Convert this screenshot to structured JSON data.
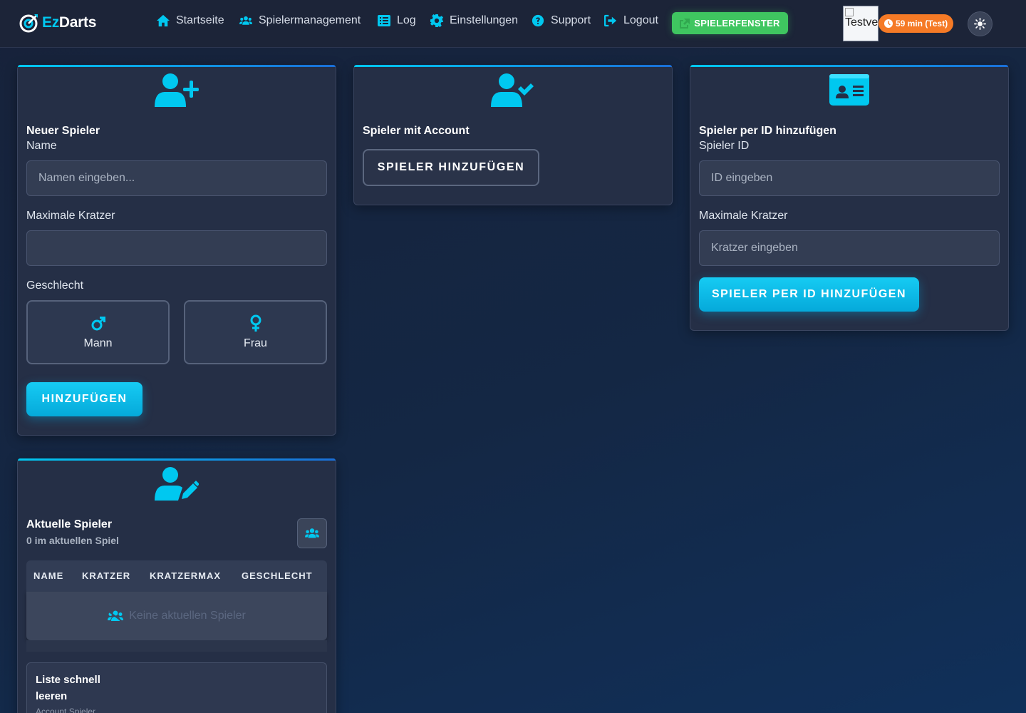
{
  "navbar": {
    "brand": {
      "ez": "Ez",
      "darts": "Darts"
    },
    "items": [
      {
        "label": "Startseite",
        "icon": "home-icon"
      },
      {
        "label": "Spielermanagement",
        "icon": "users-icon"
      },
      {
        "label": "Log",
        "icon": "list-icon"
      },
      {
        "label": "Einstellungen",
        "icon": "gear-icon"
      },
      {
        "label": "Support",
        "icon": "question-circle-icon"
      },
      {
        "label": "Logout",
        "icon": "logout-icon"
      }
    ],
    "spielerfenster_label": "SPIELERFENSTER",
    "avatar_alt": "Testve",
    "timer": "59 min (Test)"
  },
  "new_player": {
    "title": "Neuer Spieler",
    "name_label": "Name",
    "name_placeholder": "Namen eingeben...",
    "max_label": "Maximale Kratzer",
    "max_value": "",
    "gender_label": "Geschlecht",
    "male_label": "Mann",
    "female_label": "Frau",
    "add_label": "HINZUFÜGEN"
  },
  "account_player": {
    "title": "Spieler mit Account",
    "add_label": "SPIELER HINZUFÜGEN"
  },
  "id_player": {
    "title": "Spieler per ID hinzufügen",
    "id_label": "Spieler ID",
    "id_placeholder": "ID eingeben",
    "max_label": "Maximale Kratzer",
    "max_placeholder": "Kratzer eingeben",
    "add_label": "SPIELER PER ID HINZUFÜGEN"
  },
  "current_players": {
    "title": "Aktuelle Spieler",
    "count_text": "0 im aktuellen Spiel",
    "columns": [
      "NAME",
      "KRATZER",
      "KRATZERMAX",
      "GESCHLECHT"
    ],
    "empty_text": "Keine aktuellen Spieler",
    "quick_clear_title": "Liste schnell leeren",
    "quick_clear_sub": "Account Spieler"
  },
  "colors": {
    "accent": "#00c8f0",
    "success": "#3fc660",
    "warning": "#f57a26",
    "card": "#252f46"
  }
}
